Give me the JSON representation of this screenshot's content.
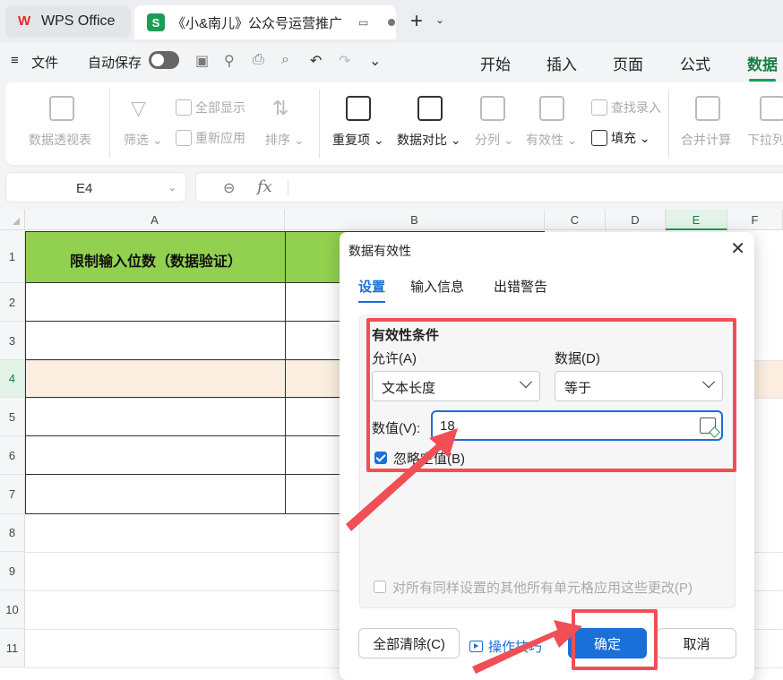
{
  "titlebar": {
    "home_tab": "WPS Office",
    "doc_tab": "《小&南儿》公众号运营推广"
  },
  "menubar": {
    "file": "文件",
    "autosave": "自动保存",
    "tabs": [
      "开始",
      "插入",
      "页面",
      "公式",
      "数据"
    ],
    "active_tab": "数据"
  },
  "ribbon": {
    "pivot": "数据透视表",
    "filter": "筛选",
    "show_all": "全部显示",
    "reapply": "重新应用",
    "sort": "排序",
    "duplicates": "重复项",
    "compare": "数据对比",
    "split": "分列",
    "validity": "有效性",
    "lookup": "查找录入",
    "fill": "填充",
    "consolidate": "合并计算",
    "dropdown": "下拉列"
  },
  "formula_bar": {
    "name_box": "E4",
    "fx": "fx"
  },
  "grid": {
    "columns": [
      "A",
      "B",
      "C",
      "D",
      "E",
      "F"
    ],
    "selected_column": "E",
    "rows": [
      "1",
      "2",
      "3",
      "4",
      "5",
      "6",
      "7",
      "8",
      "9",
      "10",
      "11"
    ],
    "selected_row": "4",
    "header_cell": "限制输入位数（数据验证）"
  },
  "dialog": {
    "title": "数据有效性",
    "tabs": [
      "设置",
      "输入信息",
      "出错警告"
    ],
    "active_tab": "设置",
    "section_title": "有效性条件",
    "allow_label": "允许(A)",
    "allow_value": "文本长度",
    "data_label": "数据(D)",
    "data_value": "等于",
    "value_label": "数值(V):",
    "value": "18",
    "ignore_blank": "忽略空值(B)",
    "ignore_blank_checked": true,
    "apply_all": "对所有同样设置的其他所有单元格应用这些更改(P)",
    "apply_all_checked": false,
    "clear_all": "全部清除(C)",
    "tips": "操作技巧",
    "ok": "确定",
    "cancel": "取消"
  },
  "colors": {
    "header_fill": "#92d050",
    "accent_green": "#1a9e55",
    "accent_blue": "#1a6fd8",
    "annotation_red": "#f04f55",
    "selected_row_fill": "#fbeee0"
  }
}
